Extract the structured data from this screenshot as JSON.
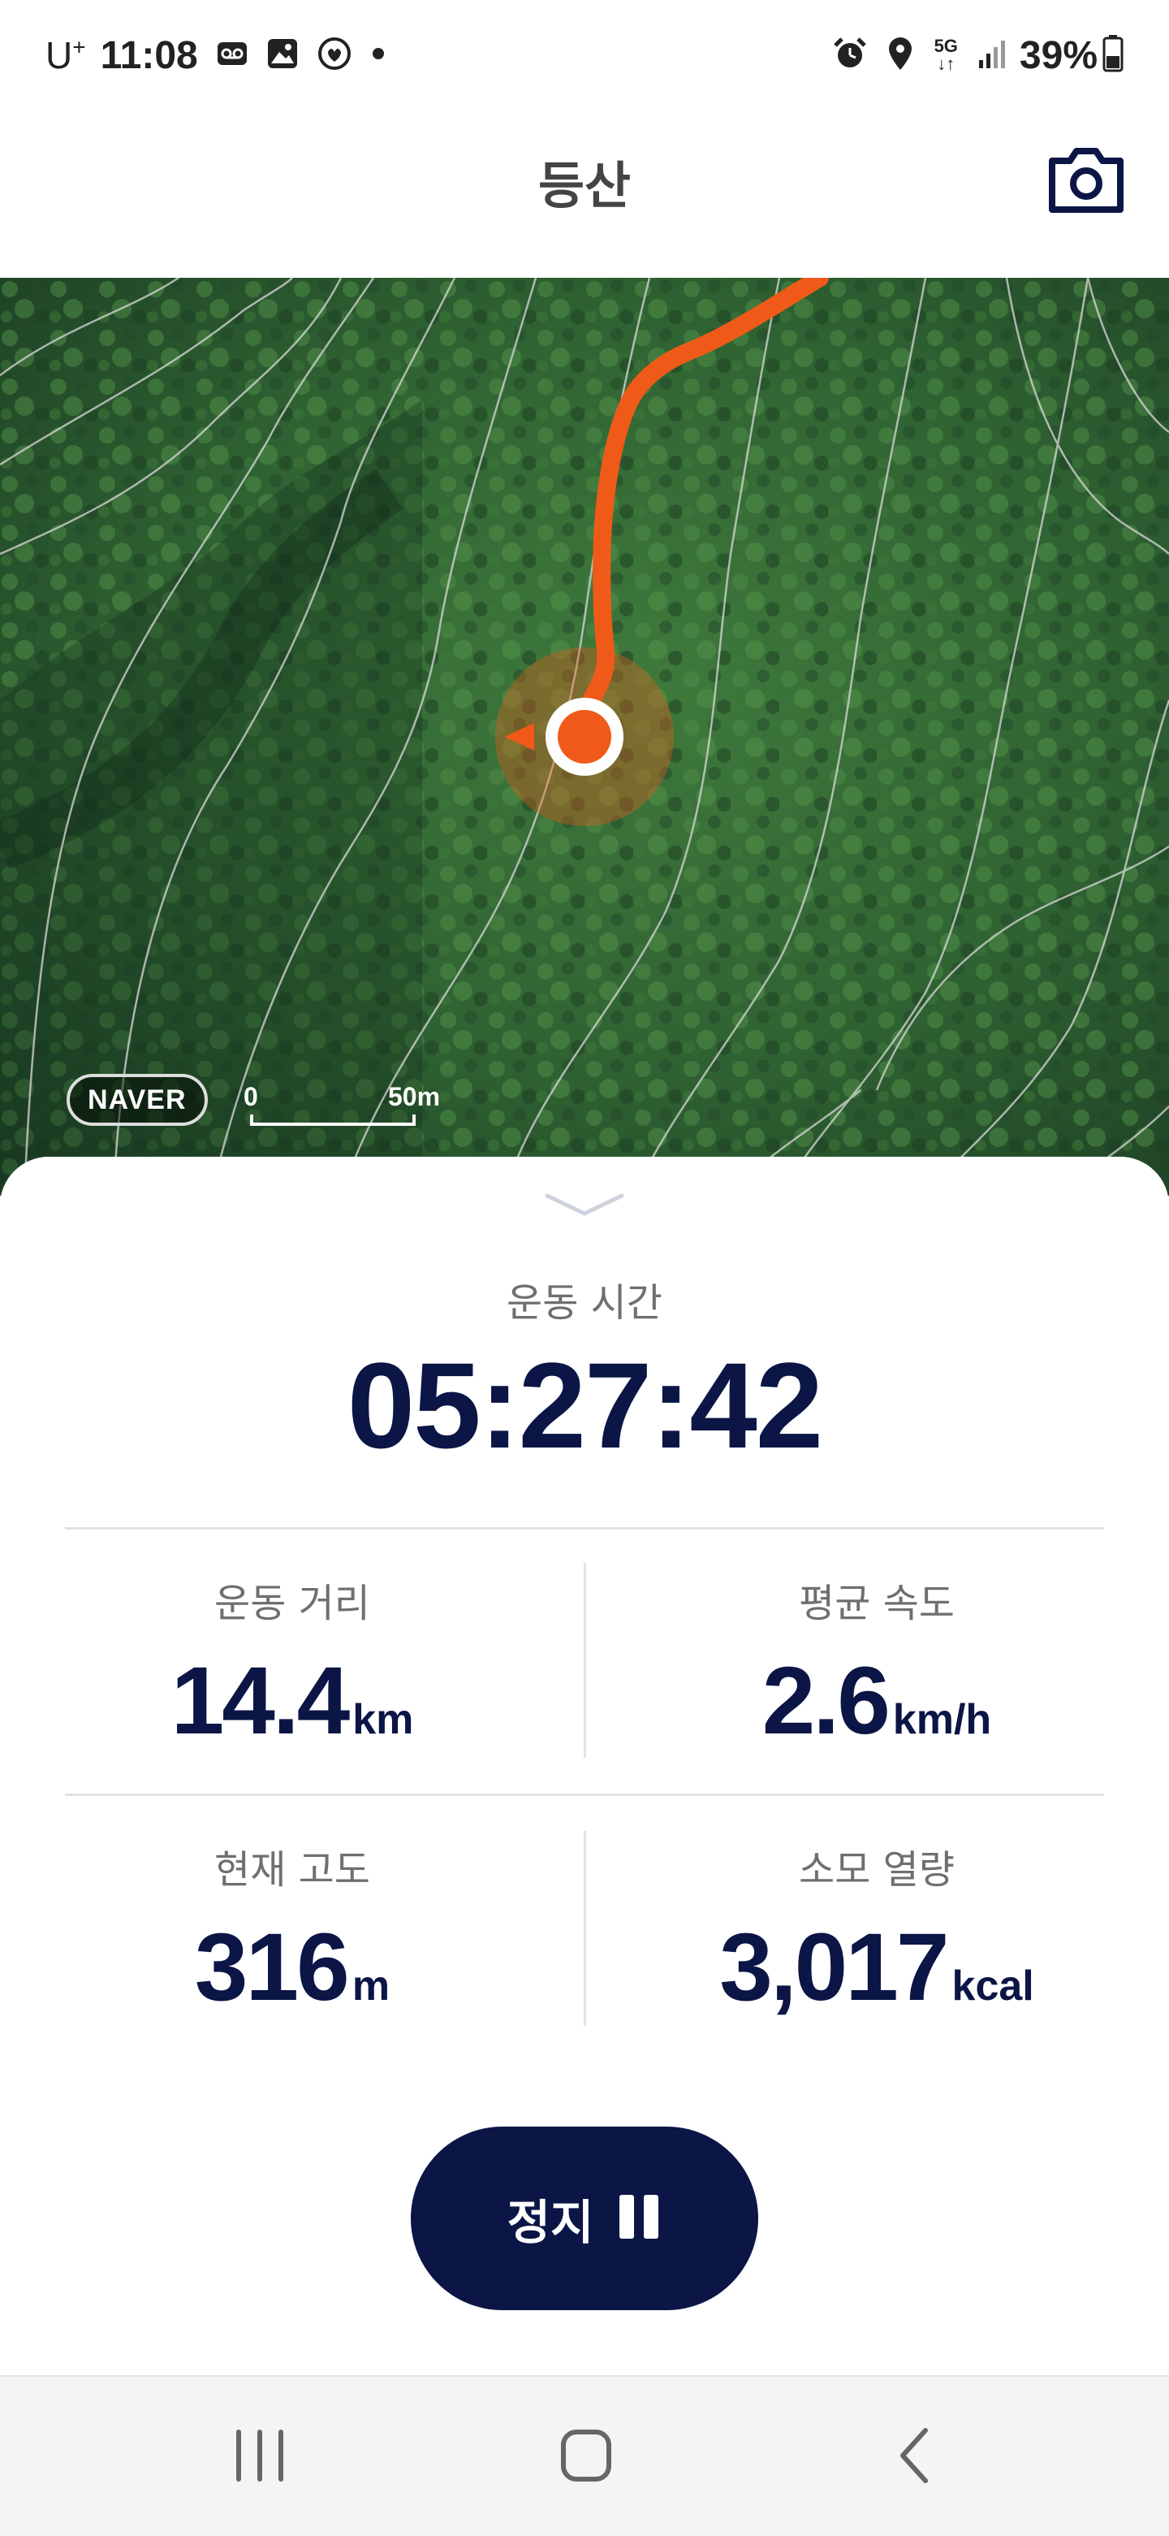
{
  "status_bar": {
    "carrier": "U",
    "carrier_sup": "+",
    "time": "11:08",
    "network": "5G",
    "battery": "39%"
  },
  "header": {
    "title": "등산",
    "camera_icon": "camera-icon"
  },
  "map": {
    "provider": "NAVER",
    "scale_start": "0",
    "scale_end": "50m",
    "track_color": "#f05a19"
  },
  "workout": {
    "time_label": "운동 시간",
    "time_value": "05:27:42",
    "stats": [
      {
        "label": "운동 거리",
        "value": "14.4",
        "unit": "km"
      },
      {
        "label": "평균 속도",
        "value": "2.6",
        "unit": "km/h"
      },
      {
        "label": "현재 고도",
        "value": "316",
        "unit": "m"
      },
      {
        "label": "소모 열량",
        "value": "3,017",
        "unit": "kcal"
      }
    ],
    "stop_label": "정지"
  },
  "colors": {
    "primary": "#0b1546",
    "accent": "#f05a19",
    "muted": "#6f6f6f"
  },
  "nav": {
    "recent_icon": "recent-apps-icon",
    "home_icon": "home-icon",
    "back_icon": "back-icon"
  }
}
